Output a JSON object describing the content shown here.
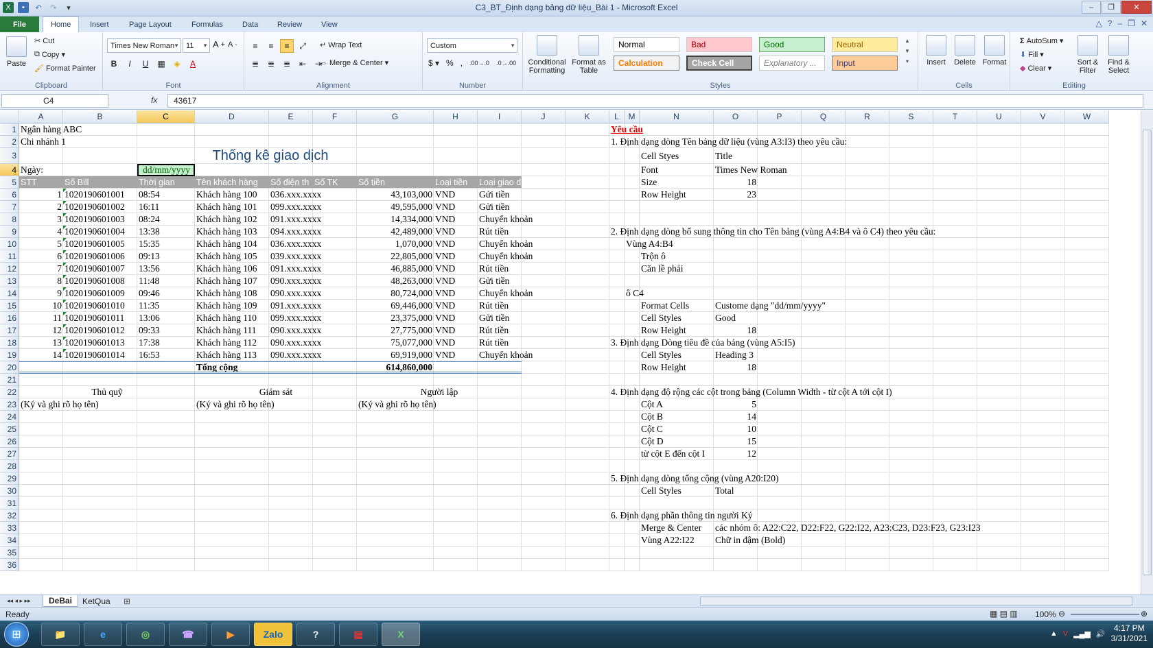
{
  "window": {
    "title": "C3_BT_Định dạng bảng dữ liệu_Bài 1  -  Microsoft Excel"
  },
  "tabs": {
    "file": "File",
    "items": [
      "Home",
      "Insert",
      "Page Layout",
      "Formulas",
      "Data",
      "Review",
      "View"
    ]
  },
  "ribbon": {
    "clipboard": {
      "label": "Clipboard",
      "paste": "Paste",
      "cut": "Cut",
      "copy": "Copy",
      "format_painter": "Format Painter"
    },
    "font": {
      "label": "Font",
      "name": "Times New Roman",
      "size": "11"
    },
    "alignment": {
      "label": "Alignment",
      "wrap": "Wrap Text",
      "merge": "Merge & Center"
    },
    "number": {
      "label": "Number",
      "format": "Custom"
    },
    "styles": {
      "label": "Styles",
      "conditional": "Conditional Formatting",
      "format_table": "Format as Table",
      "normal": "Normal",
      "bad": "Bad",
      "good": "Good",
      "neutral": "Neutral",
      "calculation": "Calculation",
      "check": "Check Cell",
      "explanatory": "Explanatory ...",
      "input": "Input"
    },
    "cells": {
      "label": "Cells",
      "insert": "Insert",
      "delete": "Delete",
      "format": "Format"
    },
    "editing": {
      "label": "Editing",
      "autosum": "AutoSum",
      "fill": "Fill",
      "clear": "Clear",
      "sort": "Sort & Filter",
      "find": "Find & Select"
    }
  },
  "formula_bar": {
    "name_box": "C4",
    "fx": "fx",
    "value": "43617"
  },
  "columns": [
    "A",
    "B",
    "C",
    "D",
    "E",
    "F",
    "G",
    "H",
    "I",
    "J",
    "K",
    "L",
    "M",
    "N",
    "O",
    "P",
    "Q",
    "R",
    "S",
    "T",
    "U",
    "V",
    "W"
  ],
  "rows": [
    "1",
    "2",
    "3",
    "4",
    "5",
    "6",
    "7",
    "8",
    "9",
    "10",
    "11",
    "12",
    "13",
    "14",
    "15",
    "16",
    "17",
    "18",
    "19",
    "20",
    "21",
    "22",
    "23",
    "24",
    "25",
    "26",
    "27",
    "28",
    "29",
    "30",
    "31",
    "32",
    "33",
    "34",
    "35",
    "36"
  ],
  "sheet": {
    "bank": "Ngân hàng ABC",
    "branch": "Chi nhánh 1",
    "title": "Thống kê giao dịch",
    "date_label": "Ngày:",
    "date_value": "dd/mm/yyyy",
    "headers": [
      "STT",
      "Số Bill",
      "Thời gian",
      "Tên khách hàng",
      "Số điện th",
      "Số TK",
      "Số tiền",
      "Loại tiền",
      "Loại giao dịch"
    ],
    "data": [
      [
        "1",
        "1020190601001",
        "08:54",
        "Khách hàng 100",
        "036.xxx.xxxx",
        "43,103,000",
        "VND",
        "Gửi tiền"
      ],
      [
        "2",
        "1020190601002",
        "16:11",
        "Khách hàng 101",
        "099.xxx.xxxx",
        "49,595,000",
        "VND",
        "Gửi tiền"
      ],
      [
        "3",
        "1020190601003",
        "08:24",
        "Khách hàng 102",
        "091.xxx.xxxx",
        "14,334,000",
        "VND",
        "Chuyển khoản"
      ],
      [
        "4",
        "1020190601004",
        "13:38",
        "Khách hàng 103",
        "094.xxx.xxxx",
        "42,489,000",
        "VND",
        "Rút tiền"
      ],
      [
        "5",
        "1020190601005",
        "15:35",
        "Khách hàng 104",
        "036.xxx.xxxx",
        "1,070,000",
        "VND",
        "Chuyển khoản"
      ],
      [
        "6",
        "1020190601006",
        "09:13",
        "Khách hàng 105",
        "039.xxx.xxxx",
        "22,805,000",
        "VND",
        "Chuyển khoản"
      ],
      [
        "7",
        "1020190601007",
        "13:56",
        "Khách hàng 106",
        "091.xxx.xxxx",
        "46,885,000",
        "VND",
        "Rút tiền"
      ],
      [
        "8",
        "1020190601008",
        "11:48",
        "Khách hàng 107",
        "090.xxx.xxxx",
        "48,263,000",
        "VND",
        "Gửi tiền"
      ],
      [
        "9",
        "1020190601009",
        "09:46",
        "Khách hàng 108",
        "090.xxx.xxxx",
        "80,724,000",
        "VND",
        "Chuyển khoản"
      ],
      [
        "10",
        "1020190601010",
        "11:35",
        "Khách hàng 109",
        "091.xxx.xxxx",
        "69,446,000",
        "VND",
        "Rút tiền"
      ],
      [
        "11",
        "1020190601011",
        "13:06",
        "Khách hàng 110",
        "099.xxx.xxxx",
        "23,375,000",
        "VND",
        "Gửi tiền"
      ],
      [
        "12",
        "1020190601012",
        "09:33",
        "Khách hàng 111",
        "090.xxx.xxxx",
        "27,775,000",
        "VND",
        "Rút tiền"
      ],
      [
        "13",
        "1020190601013",
        "17:38",
        "Khách hàng 112",
        "090.xxx.xxxx",
        "75,077,000",
        "VND",
        "Rút tiền"
      ],
      [
        "14",
        "1020190601014",
        "16:53",
        "Khách hàng 113",
        "090.xxx.xxxx",
        "69,919,000",
        "VND",
        "Chuyển khoản"
      ]
    ],
    "total_label": "Tổng cộng",
    "total_value": "614,860,000",
    "signers": [
      "Thủ quỹ",
      "Giám sát",
      "Người lập"
    ],
    "sign_note": "(Ký và ghi rõ họ tên)"
  },
  "requirements": {
    "title": "Yêu cầu",
    "r1": "1. Định dạng dòng Tên bảng dữ liệu (vùng A3:I3) theo yêu cầu:",
    "r1_rows": [
      [
        "Cell Styes",
        "Title"
      ],
      [
        "Font",
        "Times New Roman"
      ],
      [
        "Size",
        "18"
      ],
      [
        "Row Height",
        "23"
      ]
    ],
    "r2": "2. Định dạng dòng bổ sung thông tin cho Tên bảng (vùng A4:B4 và ô C4) theo yêu cầu:",
    "r2_range": "Vùng A4:B4",
    "r2_a": "Trộn ô",
    "r2_b": "Căn lề phải",
    "r2_cell": "ô C4",
    "r2_rows": [
      [
        "Format Cells",
        "Custome dạng \"dd/mm/yyyy\""
      ],
      [
        "Cell Styles",
        "Good"
      ],
      [
        "Row Height",
        "18"
      ]
    ],
    "r3": "3. Định dạng Dòng tiêu đề của bảng (vùng A5:I5)",
    "r3_rows": [
      [
        "Cell Styles",
        "Heading 3"
      ],
      [
        "Row Height",
        "18"
      ]
    ],
    "r4": "4. Định dạng độ rộng các cột trong bảng (Column Width - từ cột A tới cột I)",
    "r4_rows": [
      [
        "Cột A",
        "5"
      ],
      [
        "Cột B",
        "14"
      ],
      [
        "Cột C",
        "10"
      ],
      [
        "Cột D",
        "15"
      ],
      [
        "từ cột E đến cột I",
        "12"
      ]
    ],
    "r5": "5. Định dạng dòng tổng cộng (vùng A20:I20)",
    "r5_rows": [
      [
        "Cell Styles",
        "Total"
      ]
    ],
    "r6": "6. Định dạng phần thông tin người Ký",
    "r6_rows": [
      [
        "Merge & Center",
        "các nhóm ô: A22:C22, D22:F22, G22:I22, A23:C23, D23:F23, G23:I23"
      ],
      [
        "Vùng A22:I22",
        "Chữ in đậm (Bold)"
      ]
    ]
  },
  "sheet_tabs": [
    "DeBai",
    "KetQua"
  ],
  "status": {
    "ready": "Ready",
    "zoom": "100%"
  },
  "taskbar": {
    "time": "4:17 PM",
    "date": "3/31/2021",
    "zalo": "Zalo"
  },
  "colors": {
    "file_tab": "#2a7a3b",
    "header_fill": "#a6a6a6",
    "good_fill": "#c6efce",
    "good_text": "#006100",
    "bad_fill": "#ffc7ce",
    "neutral_fill": "#ffeb9c",
    "req_title": "#e00000"
  }
}
